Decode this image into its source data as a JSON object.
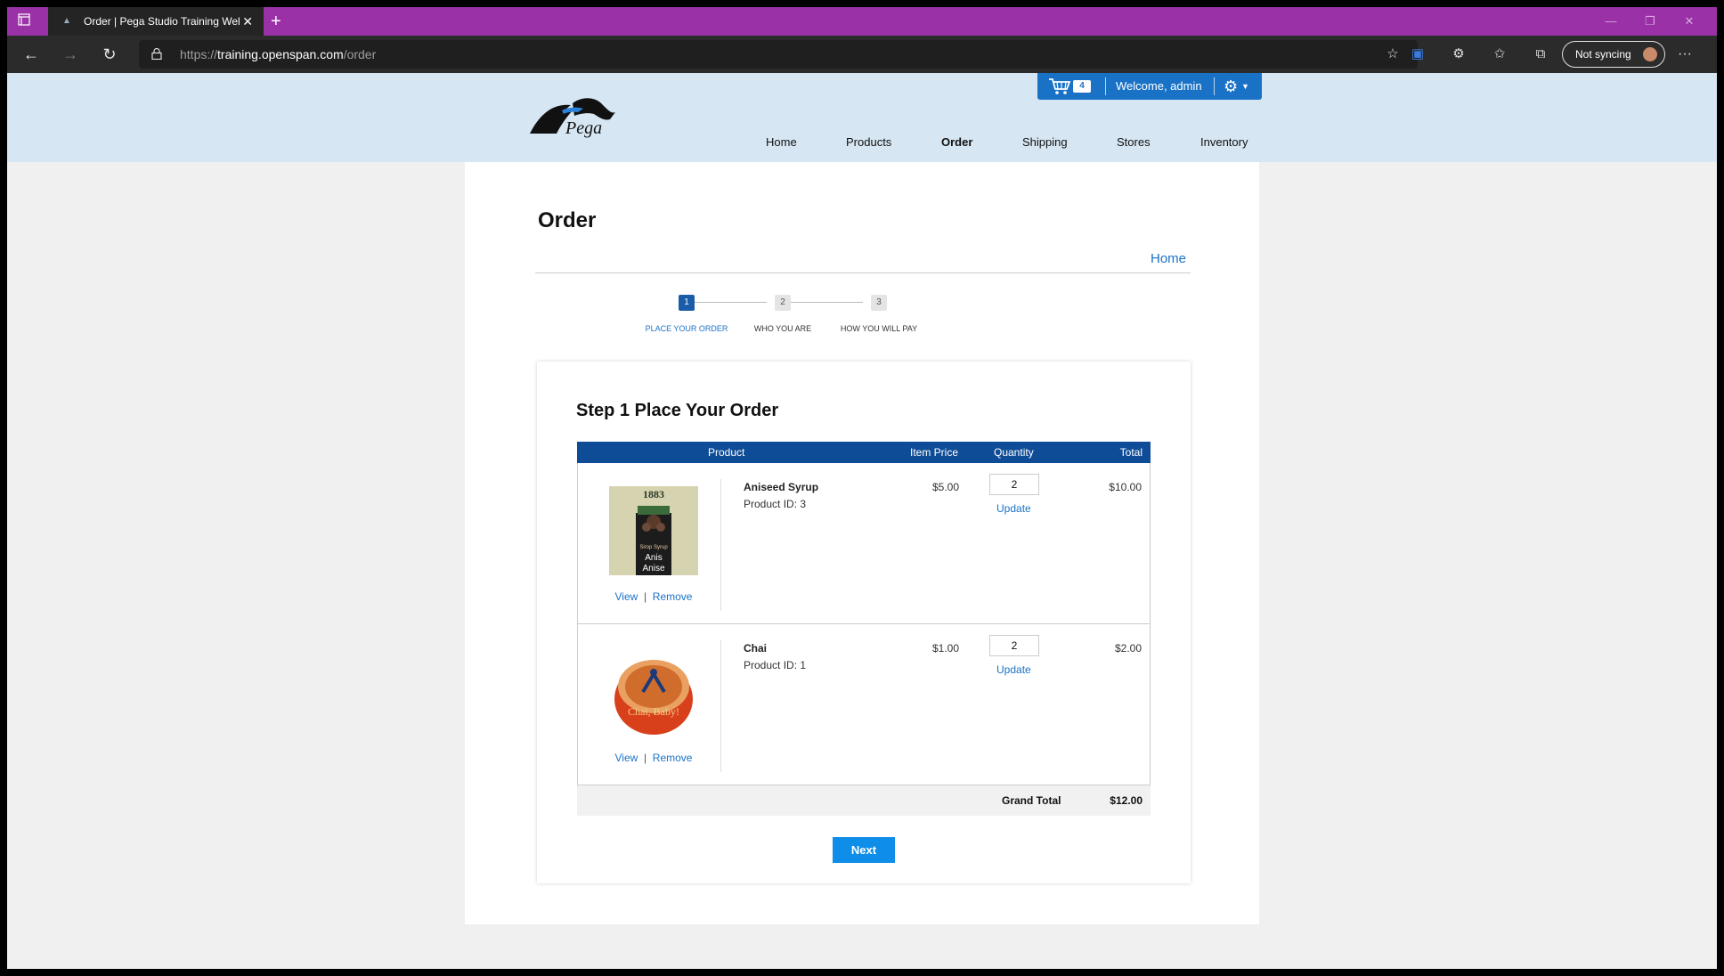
{
  "browser": {
    "tab_title": "Order | Pega Studio Training Wel",
    "url_prefix": "https://",
    "url_host": "training.openspan.com",
    "url_path": "/order",
    "sync_label": "Not syncing"
  },
  "header": {
    "logo_text": "Pega",
    "cart_count": "4",
    "welcome": "Welcome, admin",
    "nav": [
      "Home",
      "Products",
      "Order",
      "Shipping",
      "Stores",
      "Inventory"
    ],
    "active_nav": "Order"
  },
  "main": {
    "title": "Order",
    "home_link": "Home",
    "steps": [
      {
        "num": "1",
        "label": "PLACE YOUR ORDER",
        "active": true
      },
      {
        "num": "2",
        "label": "WHO YOU ARE",
        "active": false
      },
      {
        "num": "3",
        "label": "HOW YOU WILL PAY",
        "active": false
      }
    ],
    "card_title": "Step 1 Place Your Order",
    "columns": [
      "Product",
      "Item Price",
      "Quantity",
      "Total"
    ],
    "rows": [
      {
        "name": "Aniseed Syrup",
        "product_id": "Product ID: 3",
        "price": "$5.00",
        "quantity": "2",
        "update": "Update",
        "total": "$10.00",
        "view": "View",
        "remove": "Remove",
        "image_text": [
          "1883",
          "Sirop Syrup",
          "Anis",
          "Anise"
        ]
      },
      {
        "name": "Chai",
        "product_id": "Product ID: 1",
        "price": "$1.00",
        "quantity": "2",
        "update": "Update",
        "total": "$2.00",
        "view": "View",
        "remove": "Remove",
        "image_text": [
          "Chai, Baby!"
        ]
      }
    ],
    "link_separator": "|",
    "grand_total_label": "Grand Total",
    "grand_total_value": "$12.00",
    "next_label": "Next"
  },
  "colors": {
    "tabbar": "#9b31a7",
    "header_bg": "#d6e6f2",
    "table_head": "#0f4c97",
    "link": "#1a72c7",
    "next_button": "#0e8ee9"
  }
}
